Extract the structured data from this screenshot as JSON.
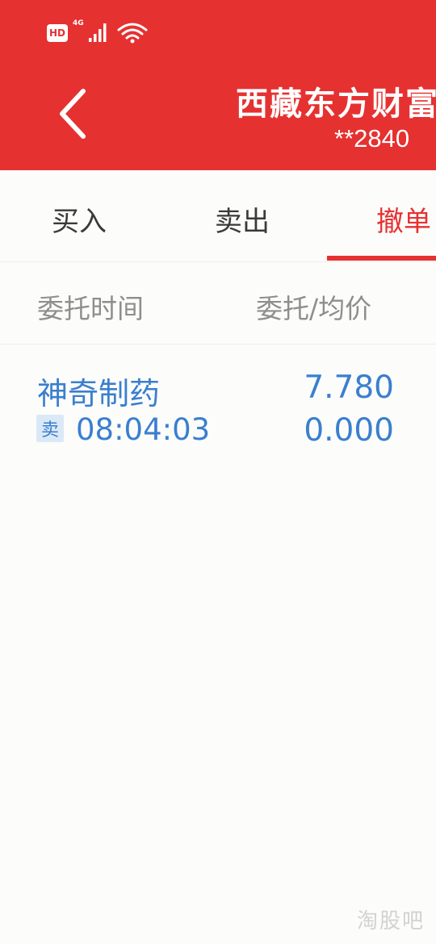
{
  "status_bar": {
    "hd_label": "HD",
    "network_label": "4G"
  },
  "header": {
    "account_name": "西藏东方财富",
    "account_number": "**2840"
  },
  "tabs": [
    {
      "label": "买入",
      "active": false
    },
    {
      "label": "卖出",
      "active": false
    },
    {
      "label": "撤单",
      "active": true
    }
  ],
  "columns": {
    "time": "委托时间",
    "price": "委托/均价"
  },
  "orders": [
    {
      "stock_name": "神奇制药",
      "side": "卖",
      "time": "08:04:03",
      "order_price": "7.780",
      "avg_price": "0.000"
    }
  ],
  "watermark": "淘股吧",
  "colors": {
    "brand_red": "#e63131",
    "data_blue": "#3a7fcf",
    "badge_bg": "#dbe9f7",
    "muted_text": "#8e8e8e",
    "background": "#fcfcfa"
  }
}
